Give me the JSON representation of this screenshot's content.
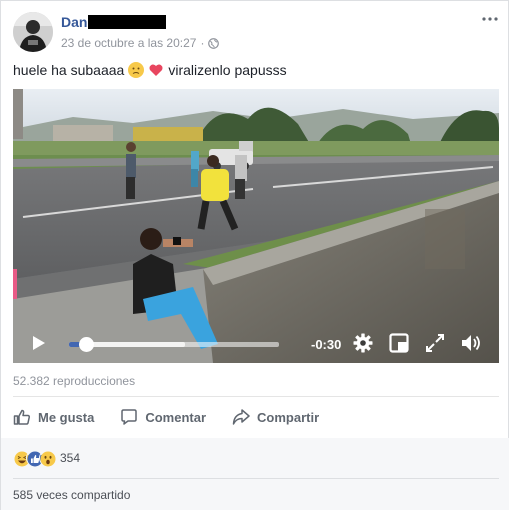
{
  "post": {
    "author_name": "Dan",
    "timestamp": "23 de octubre a las 20:27",
    "timestamp_separator": "·",
    "caption_before": "huele ha subaaaa",
    "caption_after": "viralizenlo papusss"
  },
  "video": {
    "time_remaining": "-0:30",
    "progress_played_fraction": 0.08,
    "progress_buffer_fraction": 0.55,
    "views": "52.382 reproducciones"
  },
  "actions": {
    "like_label": "Me gusta",
    "comment_label": "Comentar",
    "share_label": "Compartir"
  },
  "reactions": {
    "types": [
      "haha",
      "like",
      "wow"
    ],
    "count": "354",
    "shares": "585 veces compartido"
  },
  "colors": {
    "link_blue": "#365899",
    "brand_blue": "#4267b2",
    "secondary_text": "#90949c"
  }
}
